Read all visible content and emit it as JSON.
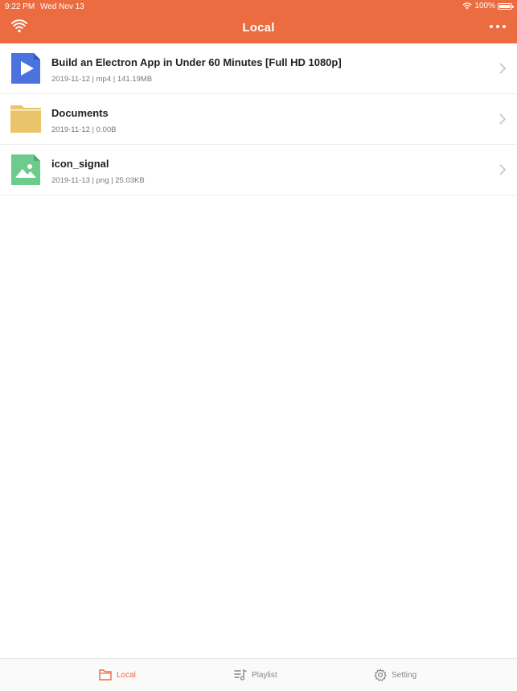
{
  "status": {
    "time": "9:22 PM",
    "date": "Wed Nov 13",
    "battery": "100%"
  },
  "header": {
    "title": "Local",
    "left_icon": "wifi-icon",
    "right_icon": "more-icon"
  },
  "files": [
    {
      "name": "Build an Electron App in Under 60 Minutes [Full HD 1080p]",
      "meta": "2019-11-12 | mp4 | 141.19MB",
      "icon": "video-file-icon"
    },
    {
      "name": "Documents",
      "meta": "2019-11-12 | 0.00B",
      "icon": "folder-icon"
    },
    {
      "name": "icon_signal",
      "meta": "2019-11-13 | png | 25.03KB",
      "icon": "image-file-icon"
    }
  ],
  "tabs": [
    {
      "label": "Local",
      "icon": "folder-icon",
      "active": true
    },
    {
      "label": "Playlist",
      "icon": "playlist-icon",
      "active": false
    },
    {
      "label": "Setting",
      "icon": "gear-icon",
      "active": false
    }
  ],
  "colors": {
    "accent": "#EC6C42",
    "video": "#4A73E0",
    "folder": "#E9C46A",
    "image": "#6DCB8E"
  }
}
